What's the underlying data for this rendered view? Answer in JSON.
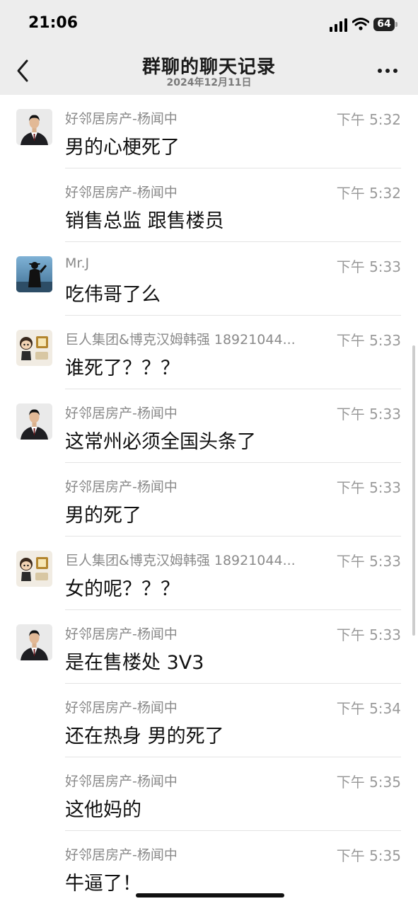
{
  "status_bar": {
    "time": "21:06",
    "battery": "64"
  },
  "nav": {
    "title": "群聊的聊天记录",
    "subtitle": "2024年12月11日"
  },
  "messages": [
    {
      "sender": "好邻居房产-杨闻中",
      "time": "下午 5:32",
      "text": "男的心梗死了",
      "avatar": "suit"
    },
    {
      "sender": "好邻居房产-杨闻中",
      "time": "下午 5:32",
      "text": "销售总监 跟售楼员",
      "avatar": ""
    },
    {
      "sender": "Mr.J",
      "time": "下午 5:33",
      "text": "吃伟哥了么",
      "avatar": "silhouette"
    },
    {
      "sender": "巨人集团&博克汉姆韩强 18921044...",
      "time": "下午 5:33",
      "text": "谁死了？？？",
      "avatar": "cartoon"
    },
    {
      "sender": "好邻居房产-杨闻中",
      "time": "下午 5:33",
      "text": "这常州必须全国头条了",
      "avatar": "suit"
    },
    {
      "sender": "好邻居房产-杨闻中",
      "time": "下午 5:33",
      "text": "男的死了",
      "avatar": ""
    },
    {
      "sender": "巨人集团&博克汉姆韩强 18921044...",
      "time": "下午 5:33",
      "text": "女的呢？？？",
      "avatar": "cartoon"
    },
    {
      "sender": "好邻居房产-杨闻中",
      "time": "下午 5:33",
      "text": "是在售楼处 3V3",
      "avatar": "suit"
    },
    {
      "sender": "好邻居房产-杨闻中",
      "time": "下午 5:34",
      "text": "还在热身 男的死了",
      "avatar": ""
    },
    {
      "sender": "好邻居房产-杨闻中",
      "time": "下午 5:35",
      "text": "这他妈的",
      "avatar": ""
    },
    {
      "sender": "好邻居房产-杨闻中",
      "time": "下午 5:35",
      "text": "牛逼了！",
      "avatar": ""
    }
  ],
  "icons": {
    "back": "chevron-left-icon",
    "more": "more-dots-icon",
    "signal": "cellular-signal-icon",
    "wifi": "wifi-icon",
    "battery": "battery-icon"
  }
}
